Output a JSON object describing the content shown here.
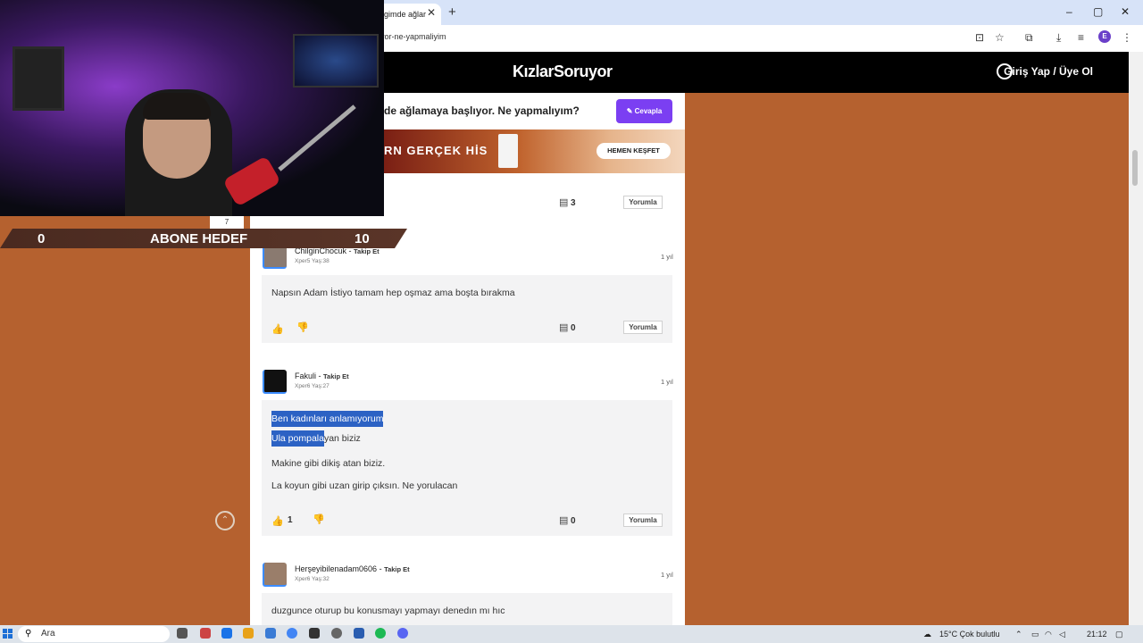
{
  "browser": {
    "tab_title": "gimde ağlar",
    "tab_close": "✕",
    "new_tab": "+",
    "url": "yor-ne-yapmaliyim",
    "window_controls": [
      "–",
      "▢",
      "✕"
    ],
    "profile_initial": "E"
  },
  "site": {
    "logo": "KızlarSoruyor",
    "login": "Giriş Yap / Üye Ol",
    "question_title": "de ağlamaya başlıyor. Ne yapmalıyım?",
    "answer_button": "✎  Cevapla",
    "ad": {
      "text": "RN GERÇEK HİS",
      "button": "HEMEN KEŞFET"
    }
  },
  "prev_card": {
    "comments": "3",
    "reply": "Yorumla"
  },
  "answers": [
    {
      "username": "ChilginChocuk",
      "follow": "Takip Et",
      "meta": "Xper5 Yaş:38",
      "age": "1 yıl",
      "lines": [
        "Napsın Adam İstiyo tamam hep oşmaz ama boşta bırakma"
      ],
      "likes": "",
      "comments": "0",
      "reply": "Yorumla"
    },
    {
      "username": "Fakuli",
      "follow": "Takip Et",
      "meta": "Xper6 Yaş:27",
      "age": "1 yıl",
      "lines": [
        "Ben kadınları anlamıyorum",
        "Ula pompala",
        "yan biziz",
        "Makine gibi dikiş atan biziz.",
        "La koyun gibi uzan girip çıksın. Ne yorulacan"
      ],
      "likes": "1",
      "comments": "0",
      "reply": "Yorumla"
    },
    {
      "username": "Herşeyibilenadam0606",
      "follow": "Takip Et",
      "meta": "Xper6 Yaş:32",
      "age": "1 yıl",
      "lines": [
        "duzgunce oturup bu konusmayı yapmayı denedın mı hıc"
      ]
    }
  ],
  "overlay": {
    "sub_left": "0",
    "sub_label": "ABONE HEDEF",
    "sub_right": "10",
    "sub_current": "7"
  },
  "taskbar": {
    "search": "Ara",
    "weather": "15°C  Çok bulutlu",
    "time": "21:12"
  },
  "colors": {
    "accent": "#7b3ff2",
    "page_bg": "#b5612f",
    "selection": "#2c62c4"
  }
}
